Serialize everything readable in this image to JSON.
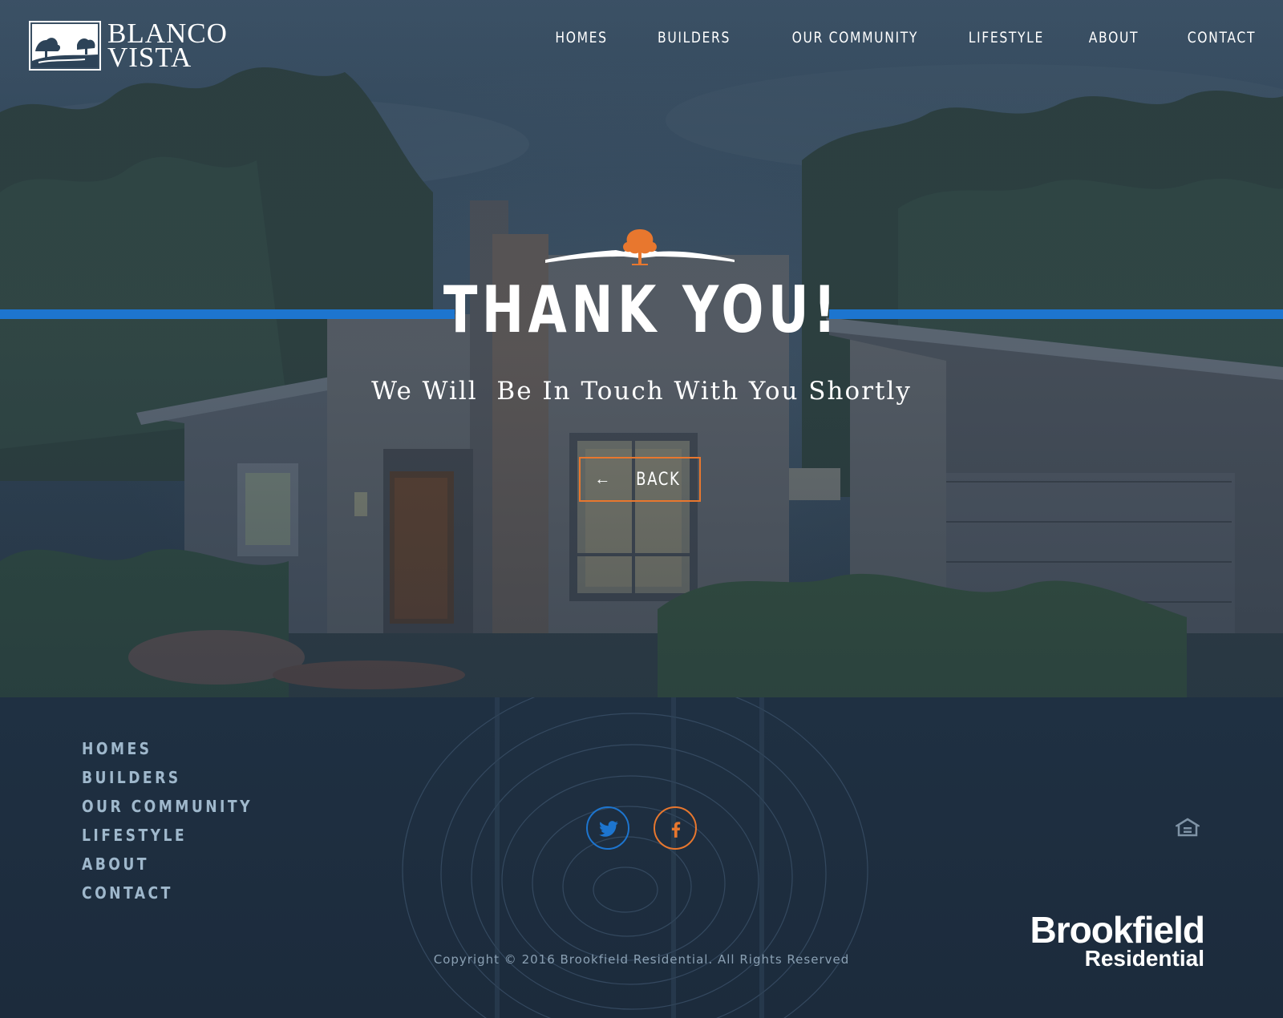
{
  "brand": {
    "logo_line1": "BLANCO",
    "logo_line2": "VISTA"
  },
  "nav": {
    "items": [
      {
        "label": "HOMES"
      },
      {
        "label": "BUILDERS"
      },
      {
        "label": "OUR COMMUNITY"
      },
      {
        "label": "LIFESTYLE"
      },
      {
        "label": "ABOUT"
      },
      {
        "label": "CONTACT"
      }
    ]
  },
  "hero": {
    "title": "THANK YOU!",
    "subtitle": "We Will  Be In Touch With You Shortly",
    "back_label": "BACK",
    "back_icon": "arrow-left-icon"
  },
  "footer": {
    "nav": [
      {
        "label": "HOMES"
      },
      {
        "label": "BUILDERS"
      },
      {
        "label": "OUR COMMUNITY"
      },
      {
        "label": "LIFESTYLE"
      },
      {
        "label": "ABOUT"
      },
      {
        "label": "CONTACT"
      }
    ],
    "social": [
      {
        "name": "twitter-icon",
        "color": "#1d75cf"
      },
      {
        "name": "facebook-icon",
        "color": "#e8772e"
      }
    ],
    "equal_housing_icon": "equal-housing-icon",
    "copyright": "Copyright © 2016 Brookfield Residential. All Rights Reserved",
    "partner_line1": "Brookfield",
    "partner_line2": "Residential"
  },
  "colors": {
    "accent_blue": "#1d75cf",
    "accent_orange": "#e8772e",
    "footer_bg": "#1c2b3c",
    "footer_text": "#9fb8cc"
  }
}
